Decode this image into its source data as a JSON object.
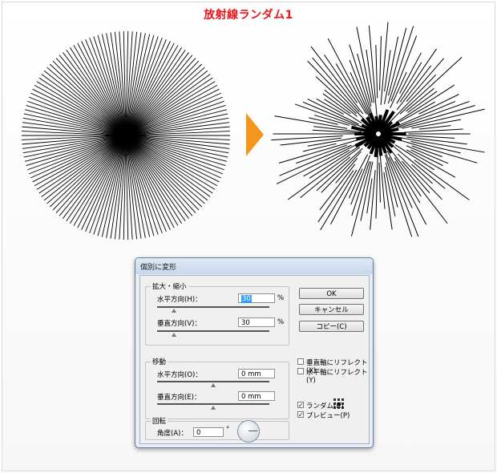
{
  "page_title": "放射線ランダム1",
  "colors": {
    "title": "#e8161b",
    "arrow": "#f5961c"
  },
  "dialog": {
    "title": "個別に変形",
    "scale_group": {
      "label": "拡大・縮小",
      "horizontal_label": "水平方向(H)：",
      "horizontal_value": "30",
      "horizontal_unit": "%",
      "vertical_label": "垂直方向(V)：",
      "vertical_value": "30",
      "vertical_unit": "%"
    },
    "move_group": {
      "label": "移動",
      "horizontal_label": "水平方向(O)：",
      "horizontal_value": "0 mm",
      "vertical_label": "垂直方向(E)：",
      "vertical_value": "0 mm"
    },
    "rotate_group": {
      "label": "回転",
      "angle_label": "角度(A)：",
      "angle_value": "0",
      "angle_unit": "°"
    },
    "buttons": {
      "ok": "OK",
      "cancel": "キャンセル",
      "copy": "コピー(C)"
    },
    "options": {
      "reflect_vertical": {
        "label": "垂直軸にリフレクト(X)",
        "checked": false
      },
      "reflect_horizontal": {
        "label": "水平軸にリフレクト(Y)",
        "checked": false
      },
      "random": {
        "label": "ランダム(R)",
        "checked": true
      },
      "preview": {
        "label": "プレビュー(P)",
        "checked": true
      }
    },
    "reference_point_icon": "reference-point-grid-icon"
  }
}
